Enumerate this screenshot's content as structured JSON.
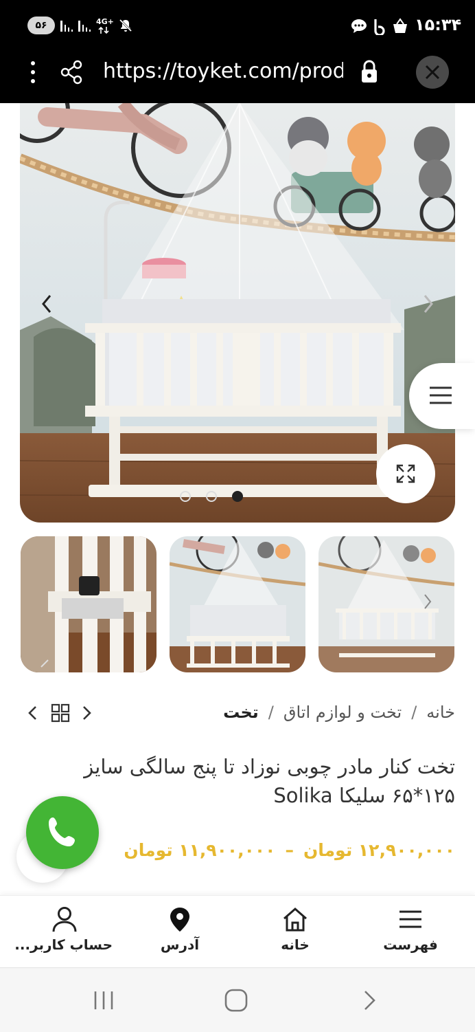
{
  "status_bar": {
    "battery": "۵۶",
    "network": "4G+",
    "time": "۱۵:۳۴",
    "icons": [
      "signal-icon",
      "signal-icon",
      "mute-icon",
      "chat-icon",
      "b-app-icon",
      "shopping-bag-icon"
    ]
  },
  "browser": {
    "url": "https://toyket.com/product",
    "icons": [
      "more-vertical-icon",
      "share-icon",
      "lock-icon",
      "close-icon"
    ]
  },
  "gallery": {
    "dots": 3,
    "active_dot": 3,
    "thumbnails": 3
  },
  "breadcrumb": {
    "home": "خانه",
    "category": "تخت و لوازم اتاق",
    "current": "تخت"
  },
  "product": {
    "title": "تخت کنار مادر چوبی نوزاد تا پنج سالگی سایز ۱۲۵*۶۵ سلیکا Solika",
    "price_high": "۱۲,۹۰۰,۰۰۰ تومان",
    "price_dash": "–",
    "price_low": "۱۱,۹۰۰,۰۰۰ تومان"
  },
  "bottom_nav": {
    "menu": "فهرست",
    "home": "خانه",
    "address": "آدرس",
    "account": "حساب کاربر..."
  },
  "colors": {
    "price": "#e6b830",
    "call": "#43b535"
  }
}
